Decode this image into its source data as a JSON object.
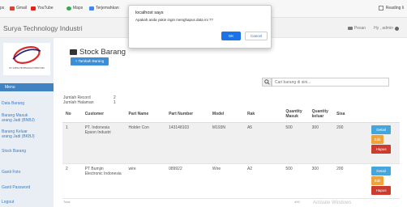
{
  "bookmarks": {
    "items": [
      {
        "label": "ps",
        "icon": "apps-icon"
      },
      {
        "label": "Gmail",
        "icon": "gmail-icon"
      },
      {
        "label": "YouTube",
        "icon": "youtube-icon"
      },
      {
        "label": "Maps",
        "icon": "maps-icon"
      },
      {
        "label": "Terjemahkan",
        "icon": "translate-icon"
      }
    ],
    "reading_list": "Reading li"
  },
  "header": {
    "brand": "Surya Technology Industri",
    "messages": "Pesan",
    "greeting": "Hy , admin"
  },
  "sidebar": {
    "logo_text": "PT. SURYA TECHNOLOGY INDUSTRI",
    "menu_title": "Menu",
    "items": [
      {
        "label": "Data Barang"
      },
      {
        "label": "Barang Masuk"
      },
      {
        "label": "arang Jadi (BNBJ)"
      },
      {
        "label": "Barang Keluar"
      },
      {
        "label": "arang Jadi (BKBJ)"
      },
      {
        "label": "Stock Barang"
      },
      {
        "label": "Ganti Foto"
      },
      {
        "label": "Ganti Password"
      },
      {
        "label": "Logout"
      }
    ]
  },
  "main": {
    "title": "Stock Barang",
    "add_button": "+ Tambah Barang",
    "search_placeholder": "Cari barang di sini...",
    "stats": {
      "record_label": "Jumlah Record",
      "record_value": "2",
      "page_label": "Jumlah Halaman",
      "page_value": "1"
    },
    "table": {
      "headers": [
        "No",
        "Customer",
        "Part Name",
        "Part Number",
        "Model",
        "Rak",
        "Quantity Masuk",
        "Quantity keluar",
        "Sisa",
        ""
      ],
      "rows": [
        {
          "no": "1",
          "customer": "PT. Indonesia Epson Industri",
          "part_name": "Holder Con",
          "part_number": "143148103",
          "model": "M193N",
          "rak": "A5",
          "qty_in": "500",
          "qty_out": "300",
          "sisa": "200"
        },
        {
          "no": "2",
          "customer": "PT Bumjin Electronic Indonesia",
          "part_name": "wire",
          "part_number": "089922",
          "model": "Wire",
          "rak": "A2",
          "qty_in": "500",
          "qty_out": "300",
          "sisa": "200"
        }
      ],
      "actions": {
        "detail": "Detail",
        "edit": "Edit",
        "delete": "Hapus"
      }
    },
    "footer_partial": "Total",
    "footer_value_partial": "400",
    "watermark": "Activate Windows"
  },
  "dialog": {
    "title": "localhost says",
    "message": "Apakah anda yakin ingin menghapus data ini ??",
    "ok_label": "OK",
    "cancel_label": "Cancel"
  },
  "colors": {
    "primary": "#3a8fd6",
    "menu_blue": "#3f83c3",
    "detail": "#45a6dd",
    "edit": "#f0a33a",
    "delete": "#cd3b2f",
    "dialog_ok": "#1a73e8"
  }
}
